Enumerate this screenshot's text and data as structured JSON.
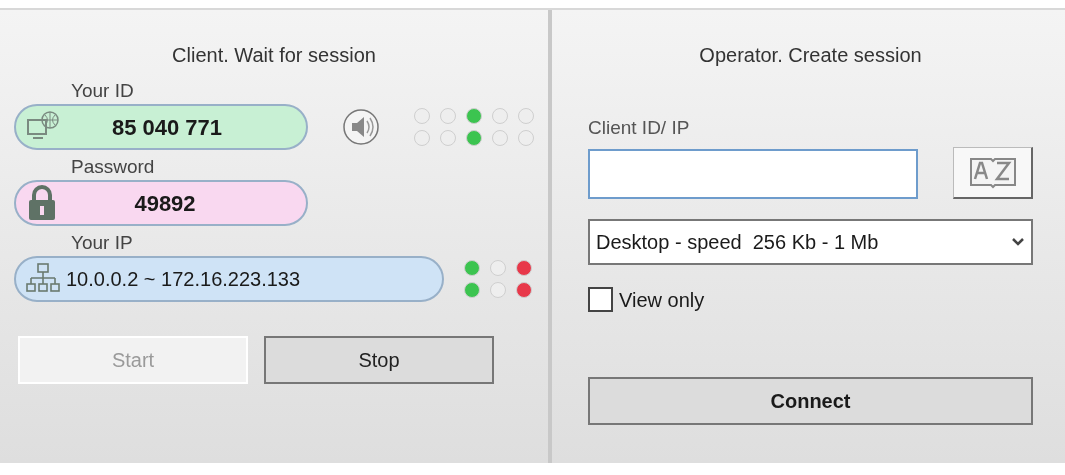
{
  "client": {
    "title": "Client. Wait for session",
    "fields": [
      {
        "kind": "id",
        "label": "Your ID",
        "value": "85 040 771",
        "color": "#c8f0d4"
      },
      {
        "kind": "password",
        "label": "Password",
        "value": "49892",
        "color": "#f9d8f0"
      },
      {
        "kind": "ip",
        "label": "Your IP",
        "value": "10.0.0.2 ~ 172.16.223.133",
        "color": "#cfe3f6"
      }
    ],
    "id_indicators": [
      [
        {
          "color": "#eeeeee"
        },
        {
          "color": "#eeeeee"
        },
        {
          "color": "#3cc450"
        },
        {
          "color": "#eeeeee"
        },
        {
          "color": "#eeeeee"
        }
      ],
      [
        {
          "color": "#eeeeee"
        },
        {
          "color": "#eeeeee"
        },
        {
          "color": "#3cc450"
        },
        {
          "color": "#eeeeee"
        },
        {
          "color": "#eeeeee"
        }
      ]
    ],
    "ip_indicators": [
      [
        {
          "color": "#3cc450"
        },
        {
          "color": "#eeeeee"
        },
        {
          "color": "#e8384a"
        }
      ],
      [
        {
          "color": "#3cc450"
        },
        {
          "color": "#eeeeee"
        },
        {
          "color": "#e8384a"
        }
      ]
    ],
    "buttons": [
      {
        "label": "Start",
        "disabled": true
      },
      {
        "label": "Stop",
        "disabled": false
      }
    ]
  },
  "operator": {
    "title": "Operator. Create session",
    "client_id_label": "Client ID/ IP",
    "speed": "Desktop - speed  256 Kb - 1 Mb",
    "view_only": {
      "label": "View only",
      "checked": false
    },
    "connect": "Connect"
  }
}
